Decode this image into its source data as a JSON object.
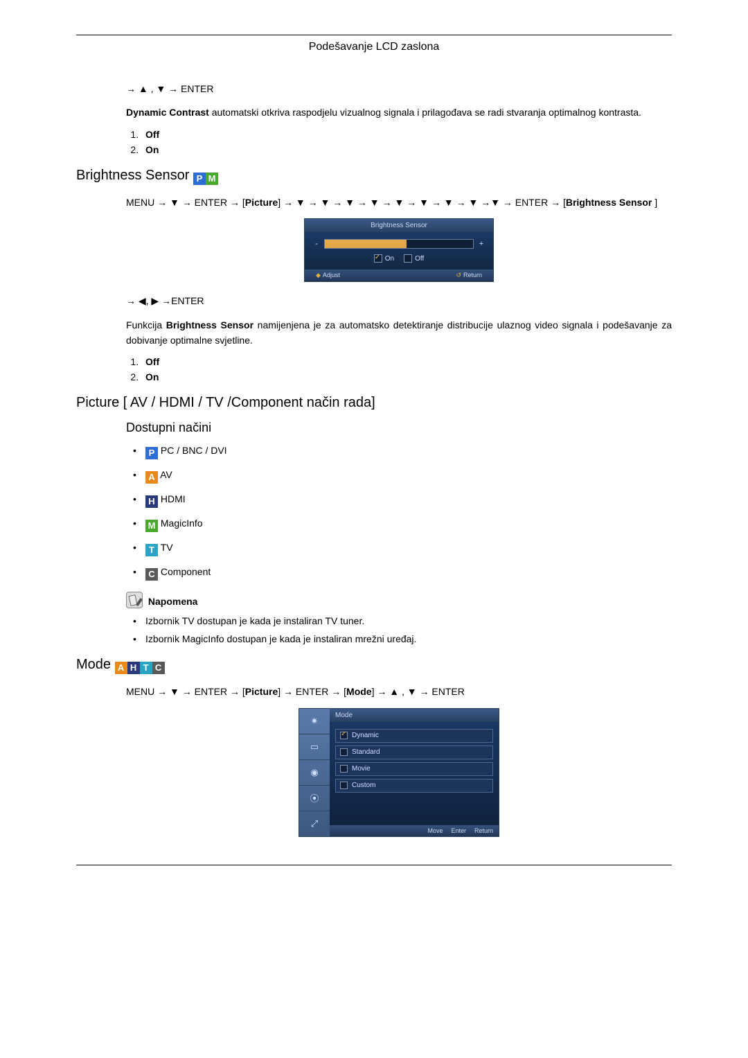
{
  "header": {
    "title": "Podešavanje LCD zaslona"
  },
  "section_dynamic": {
    "nav": "→ ▲ , ▼ → ENTER",
    "desc_prefix": "Dynamic Contrast",
    "desc_rest": " automatski otkriva raspodjelu vizualnog signala i prilagođava se radi stvaranja optimalnog kontrasta.",
    "list": [
      "Off",
      "On"
    ]
  },
  "section_brightness": {
    "heading": "Brightness Sensor",
    "menu_path_1": "MENU → ▼ → ENTER → [",
    "menu_path_picture": "Picture",
    "menu_path_2": "] → ▼ → ▼ → ▼ → ▼ → ▼ → ▼ → ▼ → ▼ →▼ → ENTER → [",
    "menu_path_bs": "Brightness Sensor",
    "menu_path_3": " ]",
    "osd": {
      "title": "Brightness Sensor",
      "minus": "-",
      "plus": "+",
      "on": "On",
      "off": "Off",
      "adjust": "Adjust",
      "return": "Return"
    },
    "nav2": "→ ◀, ▶ →ENTER",
    "desc_prefix": "Funkcija ",
    "desc_bold": "Brightness Sensor",
    "desc_rest": " namijenjena je za automatsko detektiranje distribucije ulaznog video signala i podešavanje za dobivanje optimalne svjetline.",
    "list": [
      "Off",
      "On"
    ]
  },
  "section_picture": {
    "heading": "Picture [ AV / HDMI / TV /Component način rada]",
    "sub": "Dostupni načini",
    "modes": [
      {
        "badge": "P",
        "cls": "p",
        "label": " PC / BNC / DVI"
      },
      {
        "badge": "A",
        "cls": "a",
        "label": " AV"
      },
      {
        "badge": "H",
        "cls": "h",
        "label": " HDMI"
      },
      {
        "badge": "M",
        "cls": "m",
        "label": " MagicInfo"
      },
      {
        "badge": "T",
        "cls": "t",
        "label": " TV"
      },
      {
        "badge": "C",
        "cls": "c",
        "label": " Component"
      }
    ],
    "note_title": " Napomena",
    "notes": [
      "Izbornik TV dostupan je kada je instaliran TV tuner.",
      "Izbornik MagicInfo dostupan je kada je instaliran mrežni uređaj."
    ]
  },
  "section_mode": {
    "heading": "Mode",
    "badges": [
      {
        "t": "A",
        "c": "a"
      },
      {
        "t": "H",
        "c": "h"
      },
      {
        "t": "T",
        "c": "t"
      },
      {
        "t": "C",
        "c": "c"
      }
    ],
    "menu_path": "MENU → ▼ → ENTER → [Picture] → ENTER → [Mode] → ▲ , ▼ → ENTER",
    "osd": {
      "title": "Mode",
      "items": [
        "Dynamic",
        "Standard",
        "Movie",
        "Custom"
      ],
      "side_icons": [
        "✷",
        "▭",
        "◉",
        "⦿",
        "⤢"
      ],
      "move": "Move",
      "enter": "Enter",
      "return": "Return"
    }
  }
}
